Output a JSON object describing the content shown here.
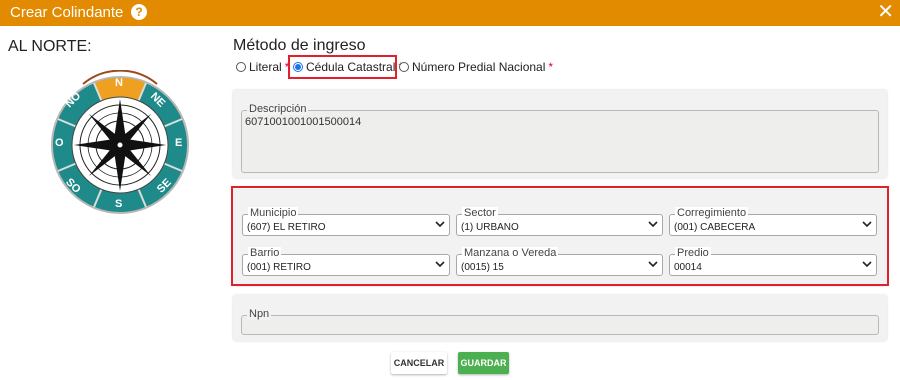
{
  "window": {
    "title": "Crear Colindante",
    "help_icon_glyph": "?",
    "close_icon_glyph": "✕",
    "accent_color": "#e28a00"
  },
  "side": {
    "title": "AL NORTE:",
    "compass": {
      "labels": {
        "n": "N",
        "ne": "NE",
        "e": "E",
        "se": "SE",
        "s": "S",
        "so": "SO",
        "o": "O",
        "no": "NO"
      },
      "ring_color": "#1f8a8a",
      "active_color": "#f0a020"
    }
  },
  "method": {
    "title": "Método de ingreso",
    "options": [
      {
        "label": "Literal",
        "required": "*",
        "selected": false
      },
      {
        "label": "Cédula Catastral",
        "required": "*",
        "selected": true
      },
      {
        "label": "Número Predial Nacional",
        "required": "*",
        "selected": false
      }
    ]
  },
  "description": {
    "label": "Descripción",
    "value": "6071001001001500014"
  },
  "filters": {
    "municipio": {
      "label": "Municipio",
      "value": "(607) EL RETIRO"
    },
    "sector": {
      "label": "Sector",
      "value": "(1) URBANO"
    },
    "corregimiento": {
      "label": "Corregimiento",
      "value": "(001) CABECERA"
    },
    "barrio": {
      "label": "Barrio",
      "value": "(001) RETIRO"
    },
    "manzana": {
      "label": "Manzana o Vereda",
      "value": "(0015) 15"
    },
    "predio": {
      "label": "Predio",
      "value": "00014"
    }
  },
  "npn": {
    "label": "Npn",
    "value": ""
  },
  "actions": {
    "cancel_label": "CANCELAR",
    "save_label": "GUARDAR",
    "save_color": "#4caf50"
  }
}
